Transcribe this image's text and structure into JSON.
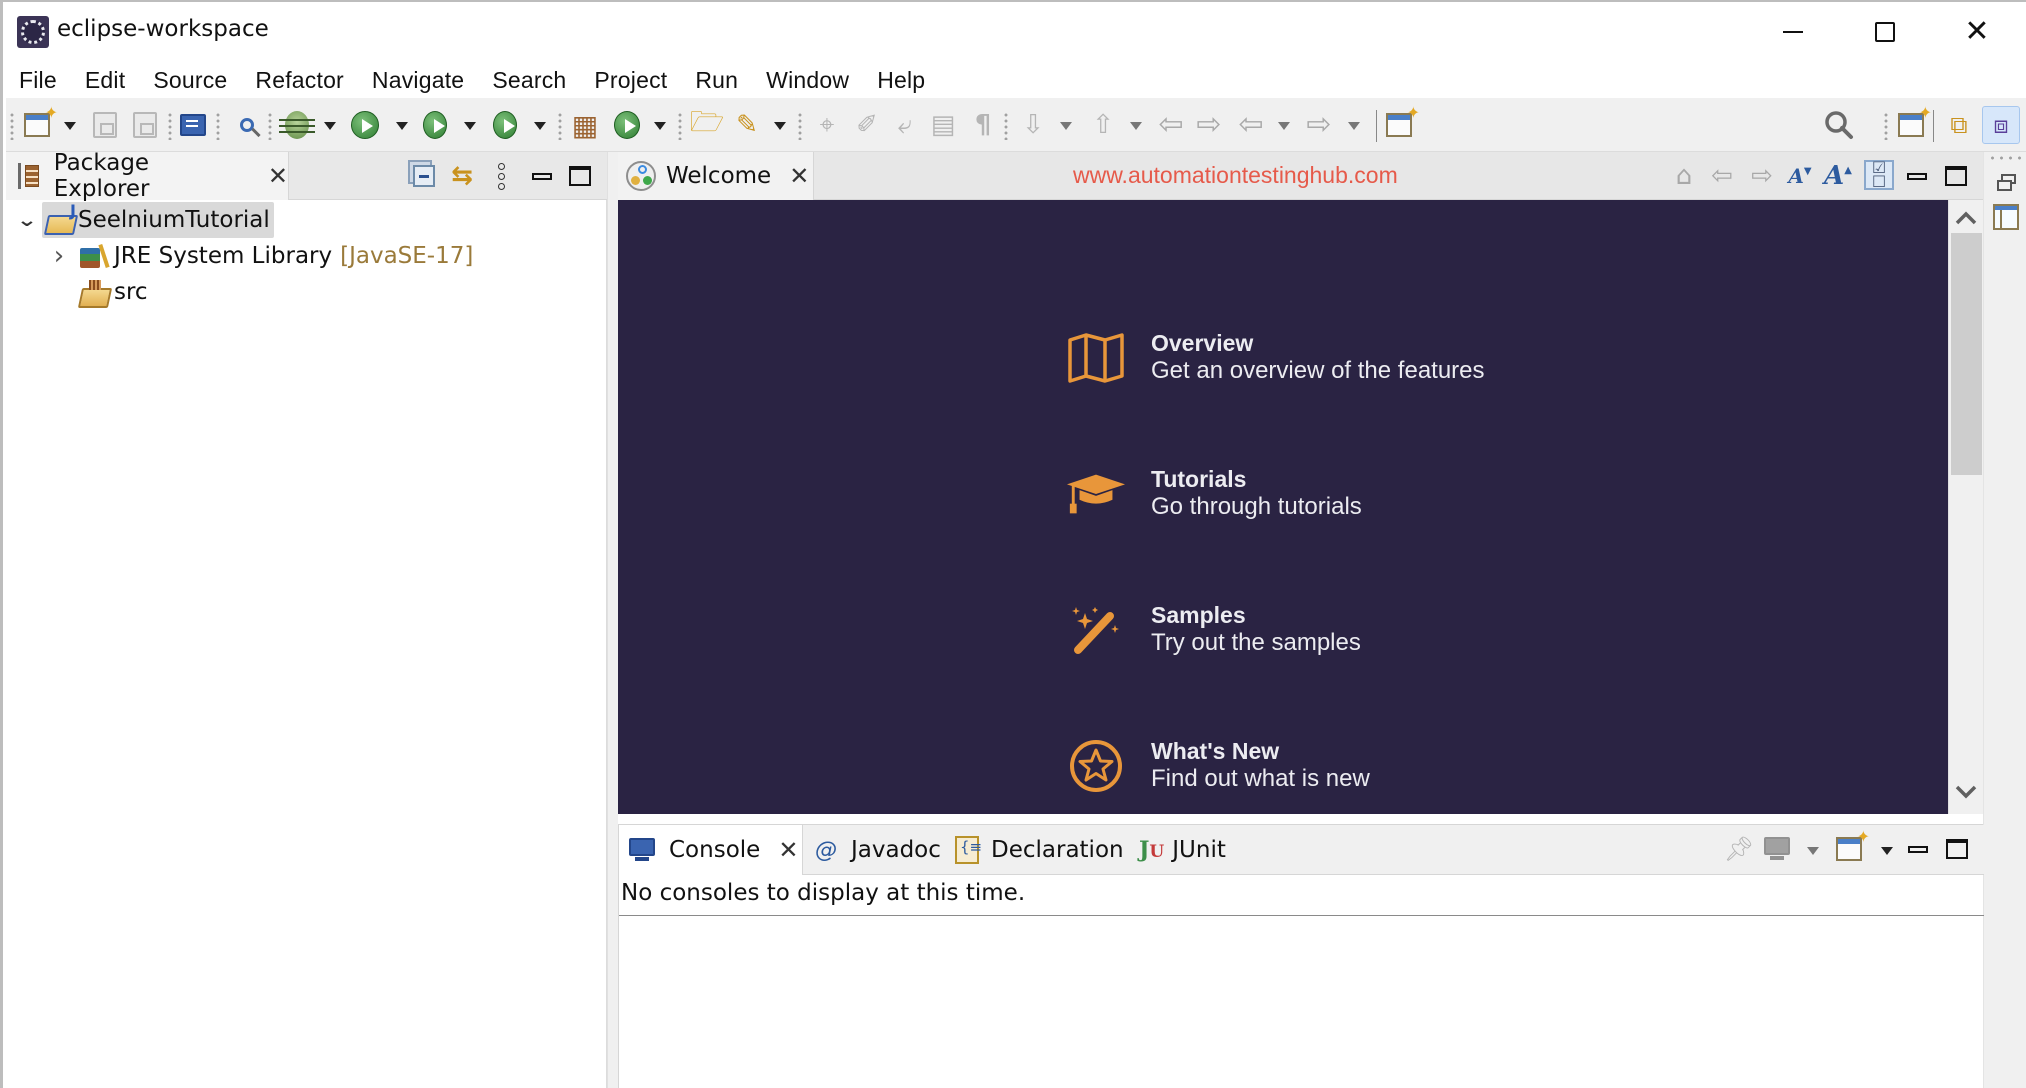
{
  "window": {
    "title": "eclipse-workspace",
    "controls": {
      "minimize": "minimize",
      "maximize": "maximize",
      "close": "✕"
    }
  },
  "menubar": {
    "items": [
      "File",
      "Edit",
      "Source",
      "Refactor",
      "Navigate",
      "Search",
      "Project",
      "Run",
      "Window",
      "Help"
    ]
  },
  "toolbar": {
    "items": [
      "new-wizard",
      "save",
      "save-all",
      "open-console",
      "toggle-breakpoints-skip",
      "debug",
      "run",
      "coverage",
      "run-external-tools",
      "new-java-package",
      "new-java-class",
      "open-type",
      "open-task",
      "toggle-mark-occurrences",
      "toggle-edit",
      "toggle-word-wrap",
      "toggle-block-selection",
      "show-whitespace",
      "next-annotation",
      "previous-annotation",
      "last-edit-location-back",
      "last-edit-location-forward",
      "back",
      "forward",
      "pin-editor",
      "search",
      "open-perspective",
      "java-ee-perspective",
      "java-perspective"
    ]
  },
  "package_explorer": {
    "tab_label": "Package Explorer",
    "close_glyph": "✕",
    "tree": [
      {
        "label": "SeelniumTutorial",
        "expanded": true,
        "selected": true,
        "chevron": "⌄"
      },
      {
        "label": "JRE System Library",
        "decoration": "[JavaSE-17]",
        "expanded": false,
        "chevron": "›"
      },
      {
        "label": "src"
      }
    ]
  },
  "editor": {
    "tab_label": "Welcome",
    "close_glyph": "✕",
    "watermark": "www.automationtestinghub.com",
    "bg_color": "#2a2343",
    "accent_color": "#e8963a",
    "items": [
      {
        "title": "Overview",
        "description": "Get an overview of the features",
        "icon": "map-icon"
      },
      {
        "title": "Tutorials",
        "description": "Go through tutorials",
        "icon": "graduation-cap-icon"
      },
      {
        "title": "Samples",
        "description": "Try out the samples",
        "icon": "magic-wand-icon"
      },
      {
        "title": "What's New",
        "description": "Find out what is new",
        "icon": "star-icon"
      }
    ],
    "scroll_up": "⌃",
    "scroll_down": "⌄",
    "font_smaller": "A",
    "font_larger": "A"
  },
  "console_panel": {
    "tabs": [
      {
        "label": "Console",
        "active": true,
        "close_glyph": "✕"
      },
      {
        "label": "Javadoc",
        "icon_glyph": "@"
      },
      {
        "label": "Declaration"
      },
      {
        "label": "JUnit",
        "icon_glyph": "Ju"
      }
    ],
    "message": "No consoles to display at this time."
  }
}
